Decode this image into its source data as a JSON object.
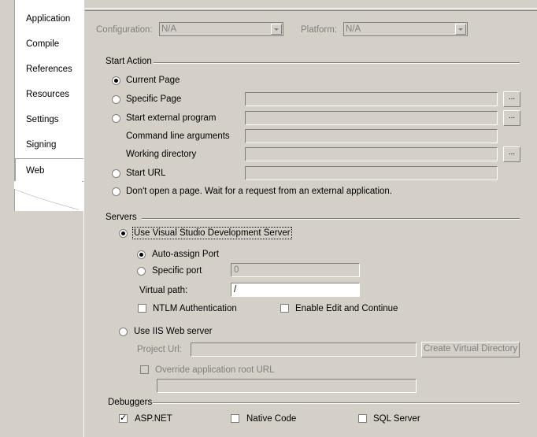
{
  "tabs": [
    {
      "label": "Application"
    },
    {
      "label": "Compile"
    },
    {
      "label": "References"
    },
    {
      "label": "Resources"
    },
    {
      "label": "Settings"
    },
    {
      "label": "Signing"
    },
    {
      "label": "Web"
    }
  ],
  "toolbar": {
    "configuration_label": "Configuration:",
    "configuration_value": "N/A",
    "platform_label": "Platform:",
    "platform_value": "N/A"
  },
  "start_action": {
    "header": "Start Action",
    "current_page": "Current Page",
    "specific_page": "Specific Page",
    "start_external_program": "Start external program",
    "command_line_arguments": "Command line arguments",
    "working_directory": "Working directory",
    "start_url": "Start URL",
    "dont_open": "Don't open a page.  Wait for a request from an external application.",
    "browse_label": "..."
  },
  "servers": {
    "header": "Servers",
    "use_vs_dev_server": "Use Visual Studio Development Server",
    "auto_assign_port": "Auto-assign Port",
    "specific_port": "Specific port",
    "specific_port_value": "0",
    "virtual_path_label": "Virtual path:",
    "virtual_path_value": "/",
    "ntlm_auth": "NTLM Authentication",
    "enable_edit_continue": "Enable Edit and Continue",
    "use_iis": "Use IIS Web server",
    "project_url_label": "Project Url:",
    "create_virtual_directory": "Create Virtual Directory",
    "override_root_url": "Override application root URL"
  },
  "debuggers": {
    "header": "Debuggers",
    "aspnet": "ASP.NET",
    "native_code": "Native Code",
    "sql_server": "SQL Server"
  }
}
